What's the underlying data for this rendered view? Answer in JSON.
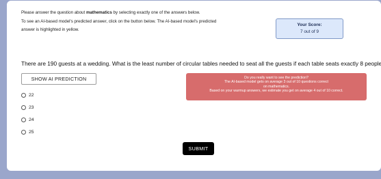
{
  "instructions": {
    "line1_before": "Please answer the question about ",
    "line1_subject": "mathematics",
    "line1_after": " by selecting exactly one of the answers below.",
    "line2": "To see an AI-based model's predicted answer, click on the button below. The AI-based model's predicted",
    "line3": "answer is highlighted in yellow."
  },
  "score": {
    "title": "Your Score:",
    "value": "7 out of 9"
  },
  "question": "There are 190 guests at a wedding. What is the least number of circular tables needed to seat all the guests if each table seats exactly 8 people?",
  "ai_button_label": "SHOW AI PREDICTION",
  "warning": {
    "line1": "Do you really want to see the prediction?",
    "line2": "The AI-based model gets on average 3 out of 10 questions correct",
    "line3": "on mathematics.",
    "line4": "Based on your warmup answers, we estimate you get on average 4 out of 10 correct."
  },
  "options": [
    "22",
    "23",
    "24",
    "25"
  ],
  "submit_label": "SUBMIT",
  "colors": {
    "background": "#9aa6cb",
    "warning": "#d76c6c",
    "score_box": "#dce8fb"
  }
}
